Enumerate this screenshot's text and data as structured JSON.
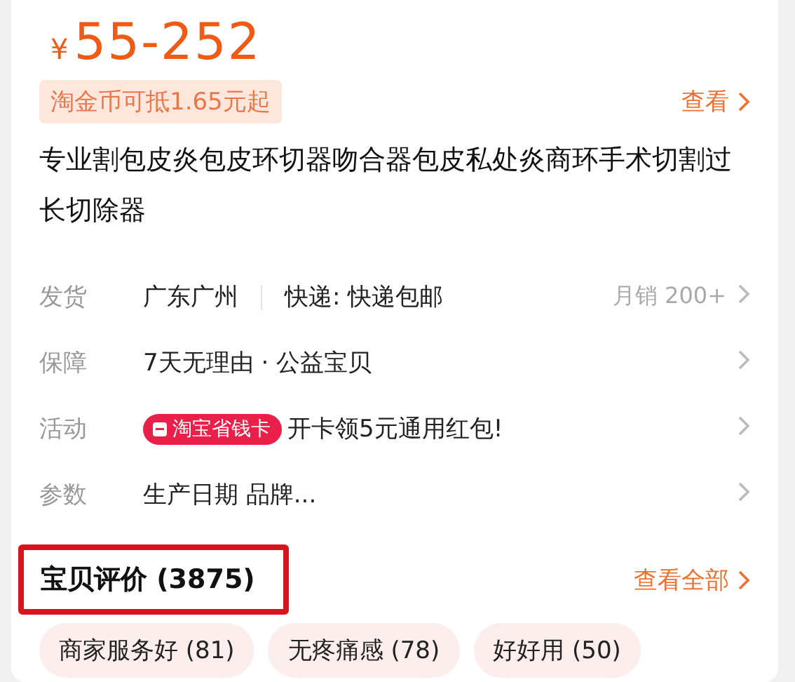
{
  "price": {
    "currency": "¥",
    "amount": "55-252"
  },
  "coin_offer": {
    "label": "淘金币可抵1.65元起",
    "action": "查看"
  },
  "title": "专业割包皮炎包皮环切器吻合器包皮私处炎商环手术切割过长切除器",
  "info_rows": [
    {
      "kind": "shipping",
      "label": "发货",
      "origin": "广东广州",
      "delivery": "快递: 快递包邮",
      "sales": "月销 200+"
    },
    {
      "kind": "text",
      "label": "保障",
      "value": "7天无理由 · 公益宝贝"
    },
    {
      "kind": "promo",
      "label": "活动",
      "badge": "淘宝省钱卡",
      "value": "开卡领5元通用红包!"
    },
    {
      "kind": "text",
      "label": "参数",
      "value": "生产日期 品牌..."
    }
  ],
  "reviews": {
    "title": "宝贝评价 (3875)",
    "highlighted": true,
    "action": "查看全部",
    "tags": [
      "商家服务好 (81)",
      "无疼痛感 (78)",
      "好好用 (50)"
    ]
  }
}
